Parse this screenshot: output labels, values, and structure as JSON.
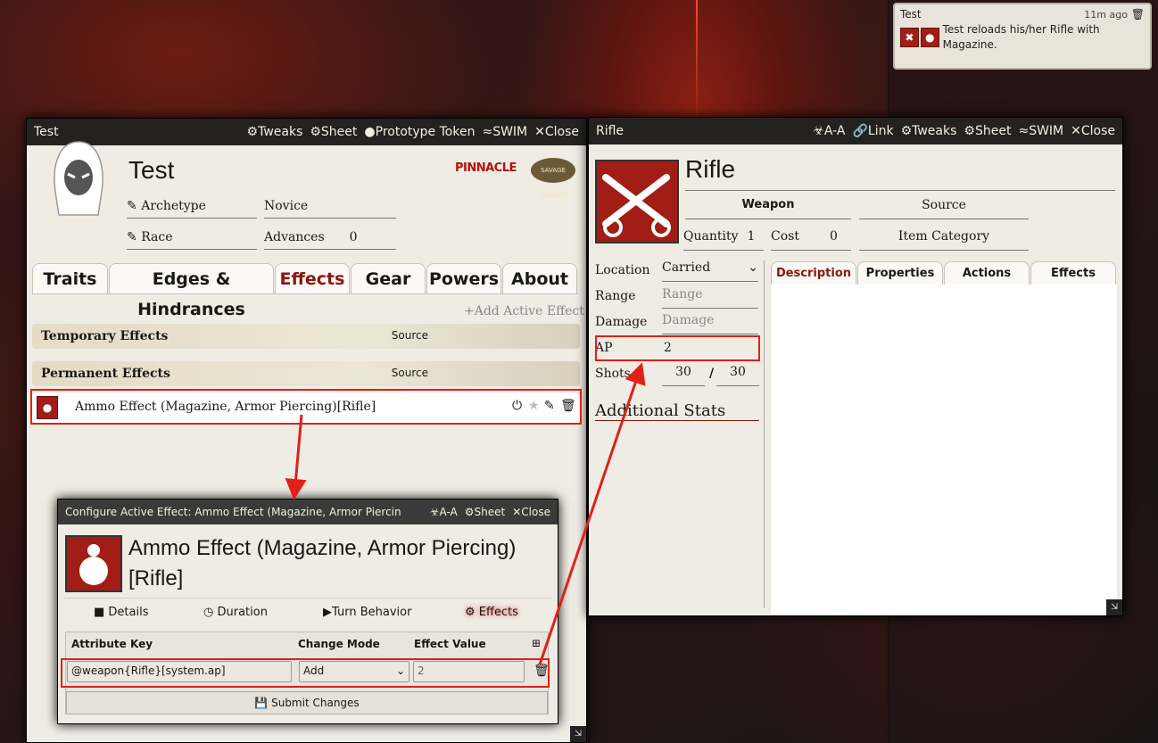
{
  "chat": {
    "speaker": "Test",
    "time": "11m ago",
    "message": "Test reloads his/her Rifle with Magazine."
  },
  "actor": {
    "bar": {
      "title": "Test",
      "tweaks": "Tweaks",
      "sheet": "Sheet",
      "proto": "Prototype Token",
      "swim": "SWIM",
      "close": "Close"
    },
    "name": "Test",
    "archetype_label": "Archetype",
    "rank": "Novice",
    "race_label": "Race",
    "advances_label": "Advances",
    "advances": "0",
    "logo1": "PINNACLE",
    "logo2": "SAVAGE WORLDS",
    "tabs": [
      "Traits",
      "Edges & Hindrances",
      "Effects",
      "Gear",
      "Powers",
      "About"
    ],
    "add_effect": "+Add Active Effect",
    "temp": "Temporary Effects",
    "perm": "Permanent Effects",
    "source": "Source",
    "effect_row": "Ammo Effect (Magazine, Armor Piercing)[Rifle]"
  },
  "item": {
    "bar": {
      "title": "Rifle",
      "aa": "A-A",
      "link": "Link",
      "tweaks": "Tweaks",
      "sheet": "Sheet",
      "swim": "SWIM",
      "close": "Close"
    },
    "name": "Rifle",
    "type": "Weapon",
    "source": "Source",
    "qty_label": "Quantity",
    "qty": "1",
    "cost_label": "Cost",
    "cost": "0",
    "category": "Item Category",
    "location_label": "Location",
    "location": "Carried",
    "range_label": "Range",
    "range_ph": "Range",
    "damage_label": "Damage",
    "damage_ph": "Damage",
    "ap_label": "AP",
    "ap": "2",
    "shots_label": "Shots",
    "shots": "30",
    "sep": "/",
    "shots_max": "30",
    "additional": "Additional Stats",
    "tabs": [
      "Description",
      "Properties",
      "Actions",
      "Effects"
    ]
  },
  "effect": {
    "bar": {
      "title": "Configure Active Effect: Ammo Effect (Magazine, Armor Piercin",
      "aa": "A-A",
      "sheet": "Sheet",
      "close": "Close"
    },
    "name": "Ammo Effect (Magazine, Armor Piercing)[Rifle]",
    "tabs": [
      "Details",
      "Duration",
      "Turn Behavior",
      "Effects"
    ],
    "col_key": "Attribute Key",
    "col_mode": "Change Mode",
    "col_value": "Effect Value",
    "key": "@weapon{Rifle}[system.ap]",
    "mode": "Add",
    "value": "2",
    "submit": "Submit Changes"
  }
}
